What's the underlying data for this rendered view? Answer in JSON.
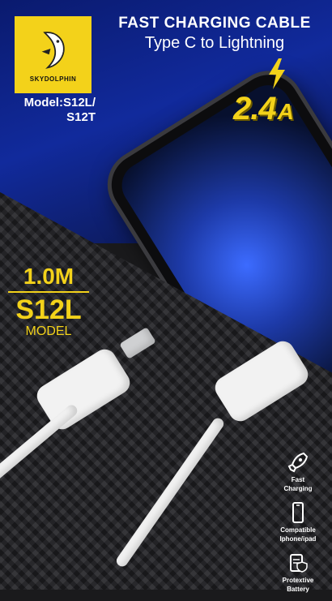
{
  "brand": {
    "name": "SKYDOLPHIN",
    "color": "#f3d21a"
  },
  "model": {
    "line1": "Model:S12L/",
    "line2": "S12T"
  },
  "title": {
    "main": "FAST CHARGING CABLE",
    "sub": "Type C to Lightning"
  },
  "current": {
    "value": "2.4",
    "unit": "A",
    "icon": "lightning-bolt-icon"
  },
  "spec": {
    "length": "1.0M",
    "model_code": "S12L",
    "model_label": "MODEL"
  },
  "features": [
    {
      "icon": "rocket-icon",
      "label_1": "Fast",
      "label_2": "Charging"
    },
    {
      "icon": "smartphone-icon",
      "label_1": "Compatible",
      "label_2": "Iphone/ipad"
    },
    {
      "icon": "shield-battery-icon",
      "label_1": "Protextive",
      "label_2": "Battery"
    }
  ]
}
